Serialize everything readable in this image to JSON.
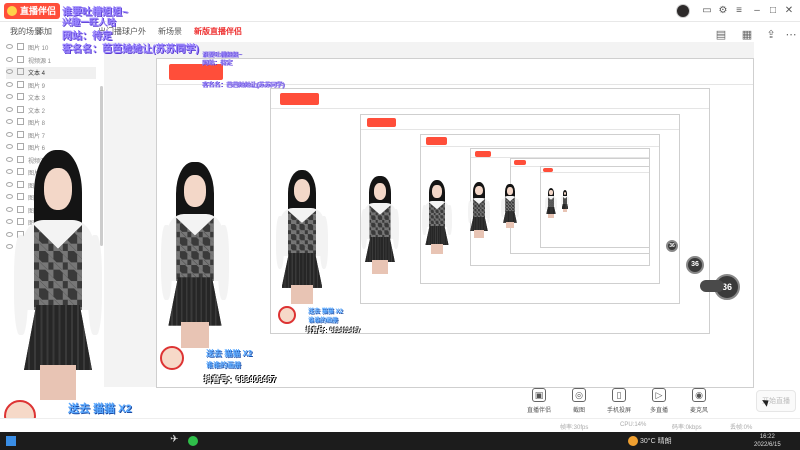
{
  "app": {
    "logo_text": "直播伴侣",
    "tabs": [
      "我的场景",
      "添加",
      "出门播球户外",
      "新场景",
      "新版直播伴侣"
    ],
    "new_tab_label": "新版直播伴侣"
  },
  "overlay": {
    "line1": "谁要吐槽姐姐~",
    "line2": "兴趣一旺人哈",
    "line3": "网站：待定",
    "line4": "客名名：芭芭她她让(苏苏同学)"
  },
  "scenes": [
    {
      "label": "图片 10",
      "active": false
    },
    {
      "label": "视频源 1",
      "active": false
    },
    {
      "label": "文本 4",
      "active": true
    },
    {
      "label": "图片 9",
      "active": false
    },
    {
      "label": "文本 3",
      "active": false
    },
    {
      "label": "文本 2",
      "active": false
    },
    {
      "label": "图片 8",
      "active": false
    },
    {
      "label": "图片 7",
      "active": false
    },
    {
      "label": "图片 6",
      "active": false
    },
    {
      "label": "视频源 2",
      "active": false
    },
    {
      "label": "图片 5",
      "active": false
    },
    {
      "label": "图片 4",
      "active": false
    },
    {
      "label": "图片 3",
      "active": false
    },
    {
      "label": "图片 2",
      "active": false
    },
    {
      "label": "图片 1",
      "active": false
    },
    {
      "label": "摄像头",
      "active": false
    },
    {
      "label": "文本 1",
      "active": false
    }
  ],
  "ticker": {
    "gift_text": "送去 猫猫 X2",
    "douyin_id": "抖音号：683403467",
    "subtitle_text": "谁谁的画册",
    "tiktok_icon": "tiktok-icon"
  },
  "bubble": {
    "value_text": "36"
  },
  "bottom_tools": [
    {
      "label": "直播伴侣",
      "icon": "screen-icon"
    },
    {
      "label": "截图",
      "icon": "camera-icon"
    },
    {
      "label": "手机投屏",
      "icon": "phone-icon"
    },
    {
      "label": "多直播",
      "icon": "play-icon"
    },
    {
      "label": "麦克风",
      "icon": "mic-icon"
    }
  ],
  "start_live_label": "开始直播",
  "statusbar": {
    "items": [
      "帧率:30fps",
      "CPU:14%",
      "码率:0kbps",
      "丢帧:0%"
    ]
  },
  "taskbar": {
    "weather": "30°C 晴朗",
    "time": "16:22",
    "date": "2022/6/15"
  },
  "colors": {
    "brand": "#ff4e3a",
    "overlay_text": "#9a86ff",
    "gift_text": "#5aa9ff",
    "taskbar": "#1c1c1c"
  }
}
